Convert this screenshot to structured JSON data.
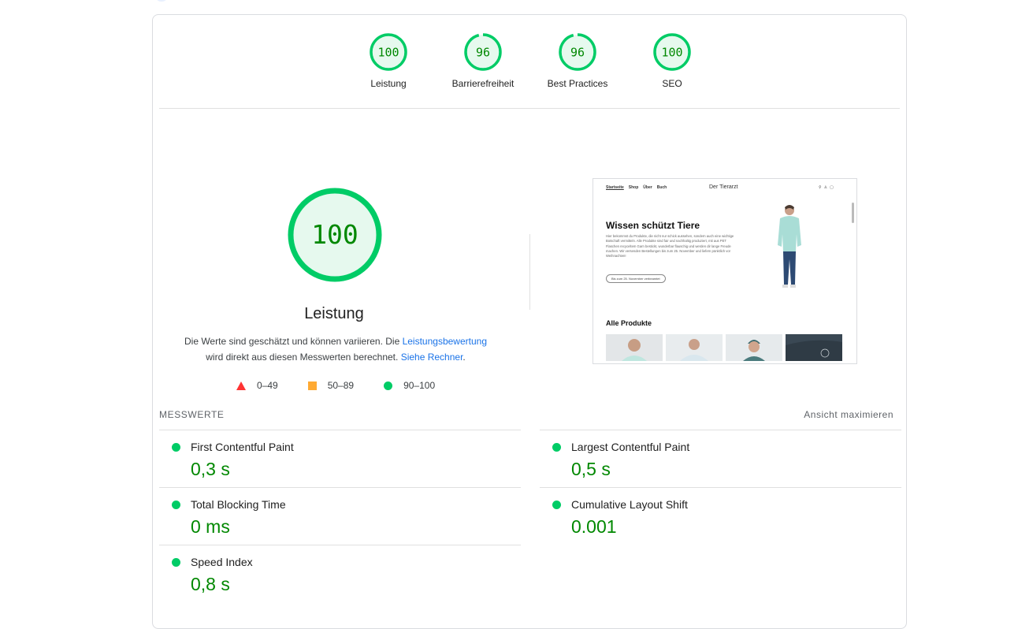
{
  "colors": {
    "pass": "#00cc66",
    "pass_text": "#008800",
    "pass_fill": "#e6f9ee",
    "average": "#ffaa33",
    "fail": "#ff3333",
    "link": "#1a73e8"
  },
  "gauges": [
    {
      "score": 100,
      "label": "Leistung"
    },
    {
      "score": 96,
      "label": "Barrierefreiheit"
    },
    {
      "score": 96,
      "label": "Best Practices"
    },
    {
      "score": 100,
      "label": "SEO"
    }
  ],
  "performance": {
    "score": 100,
    "title": "Leistung",
    "desc_part1": "Die Werte sind geschätzt und können variieren. Die ",
    "desc_link1": "Leistungsbewertung",
    "desc_part2": "wird direkt aus diesen Messwerten berechnet. ",
    "desc_link2": "Siehe Rechner",
    "desc_end": "."
  },
  "legend": {
    "fail": "0–49",
    "average": "50–89",
    "pass": "90–100"
  },
  "preview": {
    "nav": [
      "Startseite",
      "Shop",
      "Über",
      "Buch"
    ],
    "brand": "Der Tierarzt",
    "icons": [
      "search-icon",
      "account-icon",
      "cart-icon"
    ],
    "headline": "Wissen schützt Tiere",
    "body": "Hier bekommst du Produkte, die nicht nur schick aussehen, sondern auch eine wichtige Botschaft vermitteln. Alle Produkte sind fair und nachhaltig produziert, mit aus PET Flaschen recyceltem Garn bestickt, wunderbar flauschig und werden dir lange Freude machen. Wir versenden Bestellungen bis zum 25. November und liefern pünktlich vor Weihnachten!",
    "button": "Bis zum 25. November verbeamtet",
    "section": "Alle Produkte"
  },
  "metrics": {
    "heading": "MESSWERTE",
    "expand": "Ansicht maximieren",
    "items": [
      {
        "label": "First Contentful Paint",
        "value": "0,3 s"
      },
      {
        "label": "Largest Contentful Paint",
        "value": "0,5 s"
      },
      {
        "label": "Total Blocking Time",
        "value": "0 ms"
      },
      {
        "label": "Cumulative Layout Shift",
        "value": "0.001"
      },
      {
        "label": "Speed Index",
        "value": "0,8 s"
      }
    ]
  }
}
